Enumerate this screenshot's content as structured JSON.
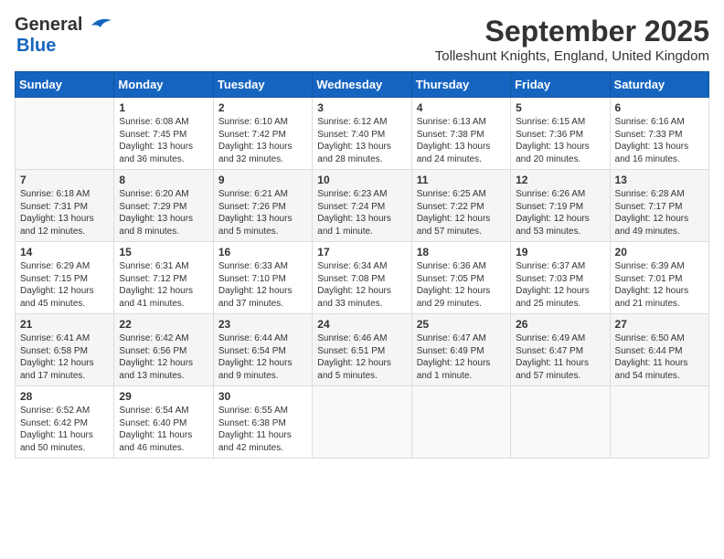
{
  "logo": {
    "line1": "General",
    "line2": "Blue"
  },
  "title": "September 2025",
  "location": "Tolleshunt Knights, England, United Kingdom",
  "headers": [
    "Sunday",
    "Monday",
    "Tuesday",
    "Wednesday",
    "Thursday",
    "Friday",
    "Saturday"
  ],
  "weeks": [
    [
      {
        "day": "",
        "content": ""
      },
      {
        "day": "1",
        "content": "Sunrise: 6:08 AM\nSunset: 7:45 PM\nDaylight: 13 hours and 36 minutes."
      },
      {
        "day": "2",
        "content": "Sunrise: 6:10 AM\nSunset: 7:42 PM\nDaylight: 13 hours and 32 minutes."
      },
      {
        "day": "3",
        "content": "Sunrise: 6:12 AM\nSunset: 7:40 PM\nDaylight: 13 hours and 28 minutes."
      },
      {
        "day": "4",
        "content": "Sunrise: 6:13 AM\nSunset: 7:38 PM\nDaylight: 13 hours and 24 minutes."
      },
      {
        "day": "5",
        "content": "Sunrise: 6:15 AM\nSunset: 7:36 PM\nDaylight: 13 hours and 20 minutes."
      },
      {
        "day": "6",
        "content": "Sunrise: 6:16 AM\nSunset: 7:33 PM\nDaylight: 13 hours and 16 minutes."
      }
    ],
    [
      {
        "day": "7",
        "content": "Sunrise: 6:18 AM\nSunset: 7:31 PM\nDaylight: 13 hours and 12 minutes."
      },
      {
        "day": "8",
        "content": "Sunrise: 6:20 AM\nSunset: 7:29 PM\nDaylight: 13 hours and 8 minutes."
      },
      {
        "day": "9",
        "content": "Sunrise: 6:21 AM\nSunset: 7:26 PM\nDaylight: 13 hours and 5 minutes."
      },
      {
        "day": "10",
        "content": "Sunrise: 6:23 AM\nSunset: 7:24 PM\nDaylight: 13 hours and 1 minute."
      },
      {
        "day": "11",
        "content": "Sunrise: 6:25 AM\nSunset: 7:22 PM\nDaylight: 12 hours and 57 minutes."
      },
      {
        "day": "12",
        "content": "Sunrise: 6:26 AM\nSunset: 7:19 PM\nDaylight: 12 hours and 53 minutes."
      },
      {
        "day": "13",
        "content": "Sunrise: 6:28 AM\nSunset: 7:17 PM\nDaylight: 12 hours and 49 minutes."
      }
    ],
    [
      {
        "day": "14",
        "content": "Sunrise: 6:29 AM\nSunset: 7:15 PM\nDaylight: 12 hours and 45 minutes."
      },
      {
        "day": "15",
        "content": "Sunrise: 6:31 AM\nSunset: 7:12 PM\nDaylight: 12 hours and 41 minutes."
      },
      {
        "day": "16",
        "content": "Sunrise: 6:33 AM\nSunset: 7:10 PM\nDaylight: 12 hours and 37 minutes."
      },
      {
        "day": "17",
        "content": "Sunrise: 6:34 AM\nSunset: 7:08 PM\nDaylight: 12 hours and 33 minutes."
      },
      {
        "day": "18",
        "content": "Sunrise: 6:36 AM\nSunset: 7:05 PM\nDaylight: 12 hours and 29 minutes."
      },
      {
        "day": "19",
        "content": "Sunrise: 6:37 AM\nSunset: 7:03 PM\nDaylight: 12 hours and 25 minutes."
      },
      {
        "day": "20",
        "content": "Sunrise: 6:39 AM\nSunset: 7:01 PM\nDaylight: 12 hours and 21 minutes."
      }
    ],
    [
      {
        "day": "21",
        "content": "Sunrise: 6:41 AM\nSunset: 6:58 PM\nDaylight: 12 hours and 17 minutes."
      },
      {
        "day": "22",
        "content": "Sunrise: 6:42 AM\nSunset: 6:56 PM\nDaylight: 12 hours and 13 minutes."
      },
      {
        "day": "23",
        "content": "Sunrise: 6:44 AM\nSunset: 6:54 PM\nDaylight: 12 hours and 9 minutes."
      },
      {
        "day": "24",
        "content": "Sunrise: 6:46 AM\nSunset: 6:51 PM\nDaylight: 12 hours and 5 minutes."
      },
      {
        "day": "25",
        "content": "Sunrise: 6:47 AM\nSunset: 6:49 PM\nDaylight: 12 hours and 1 minute."
      },
      {
        "day": "26",
        "content": "Sunrise: 6:49 AM\nSunset: 6:47 PM\nDaylight: 11 hours and 57 minutes."
      },
      {
        "day": "27",
        "content": "Sunrise: 6:50 AM\nSunset: 6:44 PM\nDaylight: 11 hours and 54 minutes."
      }
    ],
    [
      {
        "day": "28",
        "content": "Sunrise: 6:52 AM\nSunset: 6:42 PM\nDaylight: 11 hours and 50 minutes."
      },
      {
        "day": "29",
        "content": "Sunrise: 6:54 AM\nSunset: 6:40 PM\nDaylight: 11 hours and 46 minutes."
      },
      {
        "day": "30",
        "content": "Sunrise: 6:55 AM\nSunset: 6:38 PM\nDaylight: 11 hours and 42 minutes."
      },
      {
        "day": "",
        "content": ""
      },
      {
        "day": "",
        "content": ""
      },
      {
        "day": "",
        "content": ""
      },
      {
        "day": "",
        "content": ""
      }
    ]
  ]
}
